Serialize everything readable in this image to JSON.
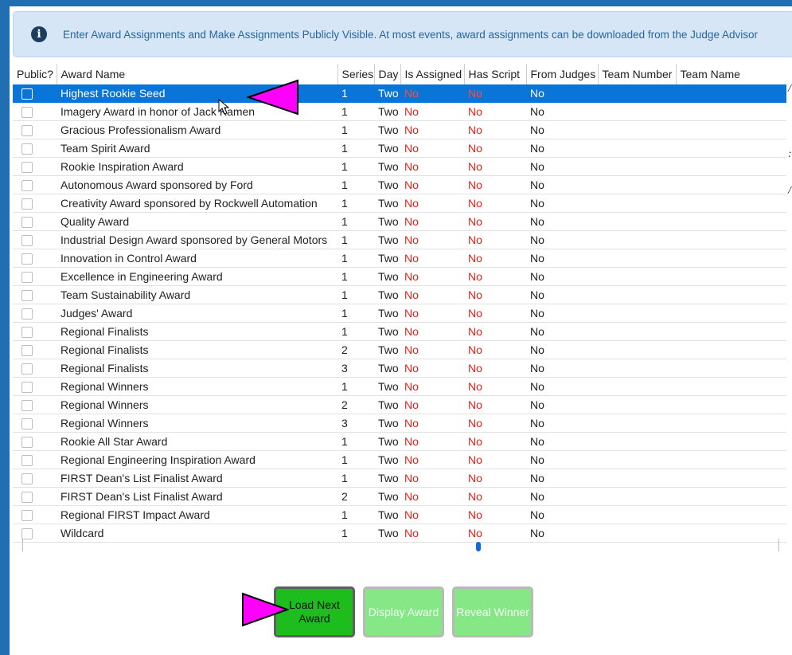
{
  "banner": {
    "icon": "info-icon",
    "text": "Enter Award Assignments and Make Assignments Publicly Visible. At most events, award assignments can be downloaded from the Judge Advisor"
  },
  "table": {
    "columns": [
      "Public?",
      "Award Name",
      "Series",
      "Day",
      "Is Assigned",
      "Has Script",
      "From Judges",
      "Team Number",
      "Team Name"
    ],
    "rows": [
      {
        "award": "Highest Rookie Seed",
        "series": "1",
        "day": "Two",
        "assigned": "No",
        "script": "No",
        "judges": "No",
        "selected": true
      },
      {
        "award": "Imagery Award in honor of Jack Kamen",
        "series": "1",
        "day": "Two",
        "assigned": "No",
        "script": "No",
        "judges": "No"
      },
      {
        "award": "Gracious Professionalism Award",
        "series": "1",
        "day": "Two",
        "assigned": "No",
        "script": "No",
        "judges": "No"
      },
      {
        "award": "Team Spirit Award",
        "series": "1",
        "day": "Two",
        "assigned": "No",
        "script": "No",
        "judges": "No"
      },
      {
        "award": "Rookie Inspiration Award",
        "series": "1",
        "day": "Two",
        "assigned": "No",
        "script": "No",
        "judges": "No"
      },
      {
        "award": "Autonomous Award sponsored by Ford",
        "series": "1",
        "day": "Two",
        "assigned": "No",
        "script": "No",
        "judges": "No"
      },
      {
        "award": "Creativity Award sponsored by Rockwell Automation",
        "series": "1",
        "day": "Two",
        "assigned": "No",
        "script": "No",
        "judges": "No"
      },
      {
        "award": "Quality Award",
        "series": "1",
        "day": "Two",
        "assigned": "No",
        "script": "No",
        "judges": "No"
      },
      {
        "award": "Industrial Design Award sponsored by General Motors",
        "series": "1",
        "day": "Two",
        "assigned": "No",
        "script": "No",
        "judges": "No"
      },
      {
        "award": "Innovation in Control Award",
        "series": "1",
        "day": "Two",
        "assigned": "No",
        "script": "No",
        "judges": "No"
      },
      {
        "award": "Excellence in Engineering Award",
        "series": "1",
        "day": "Two",
        "assigned": "No",
        "script": "No",
        "judges": "No"
      },
      {
        "award": "Team Sustainability Award",
        "series": "1",
        "day": "Two",
        "assigned": "No",
        "script": "No",
        "judges": "No"
      },
      {
        "award": "Judges' Award",
        "series": "1",
        "day": "Two",
        "assigned": "No",
        "script": "No",
        "judges": "No"
      },
      {
        "award": "Regional Finalists",
        "series": "1",
        "day": "Two",
        "assigned": "No",
        "script": "No",
        "judges": "No"
      },
      {
        "award": "Regional Finalists",
        "series": "2",
        "day": "Two",
        "assigned": "No",
        "script": "No",
        "judges": "No"
      },
      {
        "award": "Regional Finalists",
        "series": "3",
        "day": "Two",
        "assigned": "No",
        "script": "No",
        "judges": "No"
      },
      {
        "award": "Regional Winners",
        "series": "1",
        "day": "Two",
        "assigned": "No",
        "script": "No",
        "judges": "No"
      },
      {
        "award": "Regional Winners",
        "series": "2",
        "day": "Two",
        "assigned": "No",
        "script": "No",
        "judges": "No"
      },
      {
        "award": "Regional Winners",
        "series": "3",
        "day": "Two",
        "assigned": "No",
        "script": "No",
        "judges": "No"
      },
      {
        "award": "Rookie All Star Award",
        "series": "1",
        "day": "Two",
        "assigned": "No",
        "script": "No",
        "judges": "No"
      },
      {
        "award": "Regional Engineering Inspiration Award",
        "series": "1",
        "day": "Two",
        "assigned": "No",
        "script": "No",
        "judges": "No"
      },
      {
        "award": "FIRST Dean's List Finalist Award",
        "series": "1",
        "day": "Two",
        "assigned": "No",
        "script": "No",
        "judges": "No"
      },
      {
        "award": "FIRST Dean's List Finalist Award",
        "series": "2",
        "day": "Two",
        "assigned": "No",
        "script": "No",
        "judges": "No"
      },
      {
        "award": "Regional FIRST Impact Award",
        "series": "1",
        "day": "Two",
        "assigned": "No",
        "script": "No",
        "judges": "No"
      },
      {
        "award": "Wildcard",
        "series": "1",
        "day": "Two",
        "assigned": "No",
        "script": "No",
        "judges": "No"
      }
    ]
  },
  "buttons": {
    "load_next": "Load Next Award",
    "display": "Display Award",
    "reveal": "Reveal Winner"
  },
  "colors": {
    "accent": "#1f6fb2",
    "selected_row": "#0a75d9",
    "no_red": "#e8201a",
    "arrow_magenta": "#ff00ff",
    "load_green": "#1dbd1d",
    "disabled_green": "#86e786"
  }
}
